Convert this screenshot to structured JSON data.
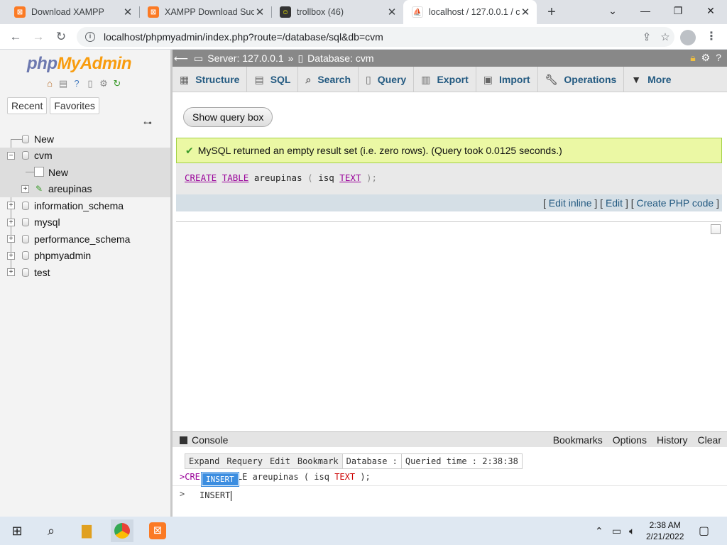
{
  "browser": {
    "tabs": [
      {
        "title": "Download XAMPP",
        "favicon": "xampp-icon",
        "active": false
      },
      {
        "title": "XAMPP Download Succ",
        "favicon": "xampp-icon",
        "active": false
      },
      {
        "title": "trollbox (46)",
        "favicon": "trollbox-icon",
        "active": false
      },
      {
        "title": "localhost / 127.0.0.1 / c",
        "favicon": "pma-icon",
        "active": true
      }
    ],
    "url": "localhost/phpmyadmin/index.php?route=/database/sql&db=cvm"
  },
  "nav": {
    "logo_php": "php",
    "logo_myadmin": "MyAdmin",
    "tabs": [
      "Recent",
      "Favorites"
    ],
    "tree": {
      "new_top": "New",
      "cvm": "cvm",
      "cvm_new": "New",
      "areupinas": "areupinas",
      "information_schema": "information_schema",
      "mysql": "mysql",
      "performance_schema": "performance_schema",
      "phpmyadmin": "phpmyadmin",
      "test": "test"
    }
  },
  "breadcrumb": {
    "server": "Server: 127.0.0.1",
    "separator": "»",
    "database": "Database: cvm"
  },
  "menu": [
    "Structure",
    "SQL",
    "Search",
    "Query",
    "Export",
    "Import",
    "Operations",
    "More"
  ],
  "main": {
    "show_query_box": "Show query box",
    "success_message": "MySQL returned an empty result set (i.e. zero rows). (Query took 0.0125 seconds.)",
    "sql": {
      "kw1": "CREATE",
      "kw2": "TABLE",
      "table": "areupinas",
      "open": "(",
      "col": "isq",
      "type": "TEXT",
      "close": ");"
    },
    "actions": {
      "edit_inline": "Edit inline",
      "edit": "Edit",
      "create_php": "Create PHP code"
    }
  },
  "console": {
    "title": "Console",
    "options": [
      "Bookmarks",
      "Options",
      "History",
      "Clear"
    ],
    "toolbar": {
      "expand": "Expand",
      "requery": "Requery",
      "edit": "Edit",
      "bookmark": "Bookmark",
      "database": "Database :",
      "queried_time": "Queried time : 2:38:38"
    },
    "history_prefix": ">CRE",
    "history_rest": "LE areupinas ( isq ",
    "history_type": "TEXT",
    "history_end": " );",
    "prompt": ">",
    "input": "INSERT",
    "autocomplete": "INSERT"
  },
  "taskbar": {
    "time": "2:38 AM",
    "date": "2/21/2022"
  },
  "colors": {
    "accent_link": "#235a81",
    "success_bg": "#ebf8a4",
    "sql_keyword": "#990099"
  }
}
